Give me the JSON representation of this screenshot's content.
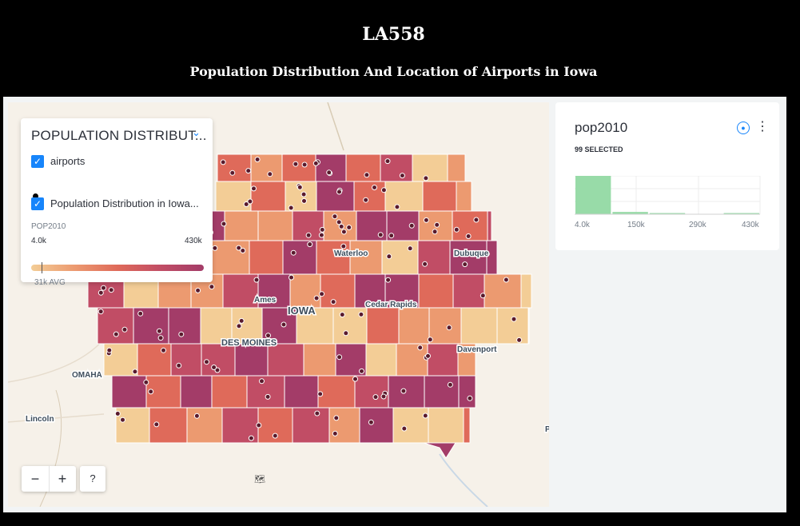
{
  "header": {
    "title": "LA558",
    "subtitle": "Population Distribution And Location of Airports in Iowa"
  },
  "legend": {
    "title": "POPULATION DISTRIBUT...",
    "layers": [
      {
        "label": "airports",
        "checked": true
      },
      {
        "label": "Population Distribution in Iowa...",
        "checked": true
      }
    ],
    "field": "POP2010",
    "min_label": "4.0k",
    "max_label": "430k",
    "avg_label": "31k AVG",
    "ramp_colors": [
      "#f3cd96",
      "#ec9a70",
      "#df6a5a",
      "#c14d65",
      "#a33c68"
    ]
  },
  "map": {
    "city_labels": [
      "Waterloo",
      "Dubuque",
      "Ames",
      "IOWA",
      "Cedar Rapids",
      "DES MOINES",
      "Davenport",
      "OMAHA",
      "Lincoln",
      "P"
    ],
    "zoom_out": "−",
    "zoom_in": "+",
    "help": "?",
    "attribution_logo": "CARTO",
    "airport_dot_color": "#5a1a2c"
  },
  "widget": {
    "title": "pop2010",
    "selected_text": "99 SELECTED",
    "drop_icon": "drop-icon",
    "menu_icon": "more-vertical-icon",
    "axis_labels": [
      "4.0k",
      "150k",
      "290k",
      "430k"
    ],
    "bar_color": "#98dba8",
    "histogram_counts_relative": [
      1.0,
      0.06,
      0.03,
      0.0,
      0.02
    ]
  }
}
